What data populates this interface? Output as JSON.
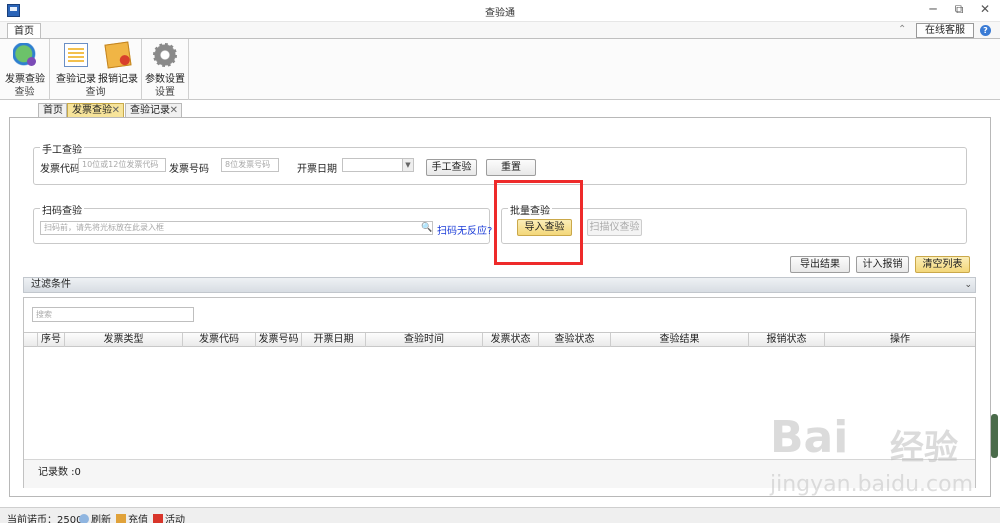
{
  "window": {
    "title": "查验通",
    "minimize": "─",
    "restore": "⧉",
    "close": "✕"
  },
  "ribbon": {
    "tab": "首页",
    "online_service": "在线客服",
    "help": "?",
    "collapse": "⌃",
    "groups": [
      {
        "label": "查验",
        "buttons": [
          {
            "label": "发票查验",
            "icon": "invoice-check-icon"
          }
        ]
      },
      {
        "label": "查询",
        "buttons": [
          {
            "label": "查验记录",
            "icon": "record-list-icon"
          },
          {
            "label": "报销记录",
            "icon": "reimburse-icon"
          }
        ]
      },
      {
        "label": "设置",
        "buttons": [
          {
            "label": "参数设置",
            "icon": "gear-icon"
          }
        ]
      }
    ]
  },
  "doc_tabs": [
    {
      "label": "首页",
      "closable": false
    },
    {
      "label": "发票查验",
      "closable": true,
      "active": true
    },
    {
      "label": "查验记录",
      "closable": true
    }
  ],
  "manual": {
    "legend": "手工查验",
    "code_label": "发票代码",
    "code_placeholder": "10位或12位发票代码",
    "number_label": "发票号码",
    "number_placeholder": "8位发票号码",
    "date_label": "开票日期",
    "date_value": "",
    "check_button": "手工查验",
    "reset_button": "重置"
  },
  "scan": {
    "legend": "扫码查验",
    "placeholder": "扫码前，请先将光标放在此录入框",
    "no_response_link": "扫码无反应?"
  },
  "batch": {
    "legend": "批量查验",
    "import_button": "导入查验",
    "scanner_button": "扫描仪查验"
  },
  "actions": {
    "export": "导出结果",
    "reimburse": "计入报销",
    "clear": "清空列表"
  },
  "filter": {
    "label": "过滤条件",
    "search_placeholder": "搜索"
  },
  "table": {
    "columns": [
      "序号",
      "发票类型",
      "发票代码",
      "发票号码",
      "开票日期",
      "查验时间",
      "发票状态",
      "查验状态",
      "查验结果",
      "报销状态",
      "操作"
    ],
    "rows": [],
    "record_count": "记录数 :0"
  },
  "status": {
    "balance": "当前诺币：2500",
    "refresh": "刷新",
    "recharge": "充值",
    "activity": "活动"
  },
  "watermark": {
    "brand": "Bai",
    "brand2": "经验",
    "url": "jingyan.baidu.com"
  }
}
